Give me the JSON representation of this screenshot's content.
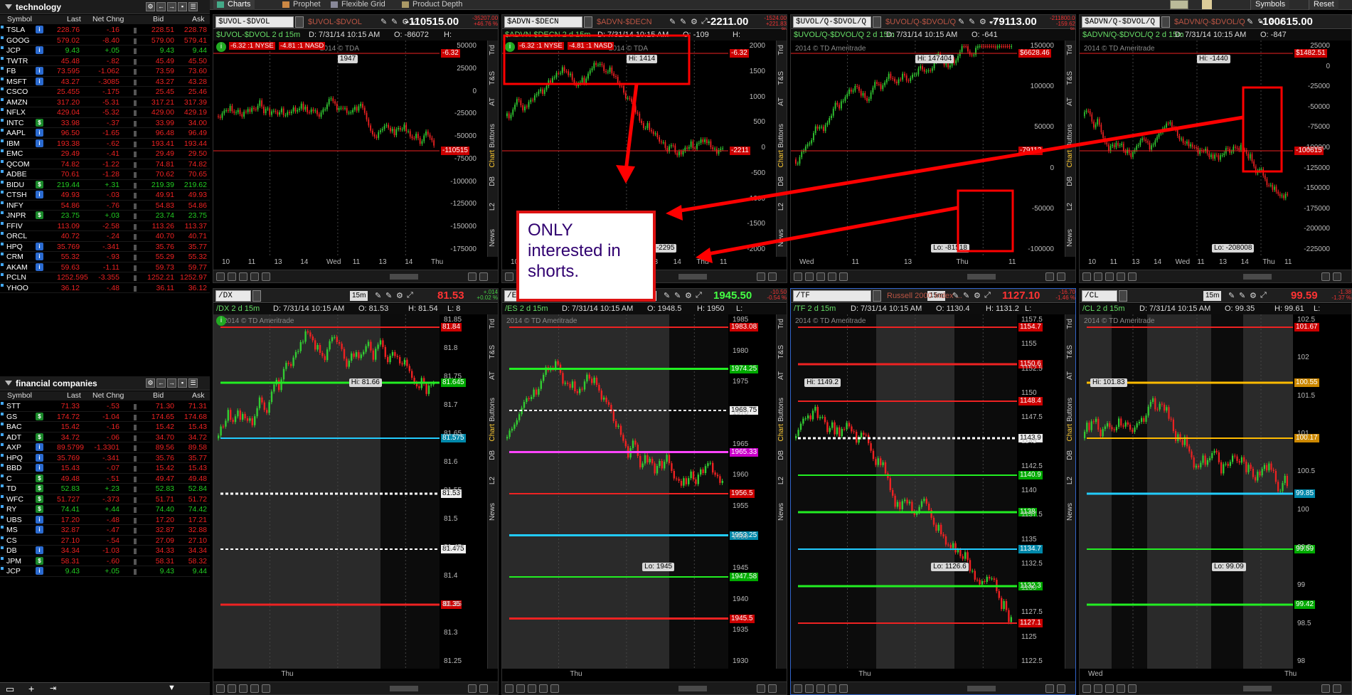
{
  "topbar": {
    "tabs": [
      "Charts",
      "Prophet",
      "Flexible Grid",
      "Product Depth"
    ],
    "right": [
      "Symbols",
      "Reset"
    ]
  },
  "watchlists": [
    {
      "title": "technology",
      "headers": [
        "Symbol",
        "Last",
        "Net Chng",
        "Bid",
        "Ask"
      ],
      "rows": [
        [
          "TSLA",
          "228.76",
          "-.16",
          "228.51",
          "228.78",
          "red",
          "blue"
        ],
        [
          "GOOG",
          "579.02",
          "-8.40",
          "579.00",
          "579.41",
          "red",
          ""
        ],
        [
          "JCP",
          "9.43",
          "+.05",
          "9.43",
          "9.44",
          "green",
          "blue"
        ],
        [
          "TWTR",
          "45.48",
          "-.82",
          "45.49",
          "45.50",
          "red",
          ""
        ],
        [
          "FB",
          "73.595",
          "-1.062",
          "73.59",
          "73.60",
          "red",
          "blue"
        ],
        [
          "MSFT",
          "43.27",
          "-.3085",
          "43.27",
          "43.28",
          "red",
          "blue"
        ],
        [
          "CSCO",
          "25.455",
          "-.175",
          "25.45",
          "25.46",
          "red",
          ""
        ],
        [
          "AMZN",
          "317.20",
          "-5.31",
          "317.21",
          "317.39",
          "red",
          ""
        ],
        [
          "NFLX",
          "429.04",
          "-5.32",
          "429.00",
          "429.19",
          "red",
          ""
        ],
        [
          "INTC",
          "33.98",
          "-.37",
          "33.99",
          "34.00",
          "red",
          "green"
        ],
        [
          "AAPL",
          "96.50",
          "-1.65",
          "96.48",
          "96.49",
          "red",
          "blue"
        ],
        [
          "IBM",
          "193.38",
          "-.62",
          "193.41",
          "193.44",
          "red",
          "blue"
        ],
        [
          "EMC",
          "29.49",
          "-.41",
          "29.49",
          "29.50",
          "red",
          ""
        ],
        [
          "QCOM",
          "74.82",
          "-1.22",
          "74.81",
          "74.82",
          "red",
          ""
        ],
        [
          "ADBE",
          "70.61",
          "-1.28",
          "70.62",
          "70.65",
          "red",
          ""
        ],
        [
          "BIDU",
          "219.44",
          "+.31",
          "219.39",
          "219.62",
          "green",
          "green"
        ],
        [
          "CTSH",
          "49.93",
          "-.03",
          "49.91",
          "49.93",
          "red",
          "blue"
        ],
        [
          "INFY",
          "54.86",
          "-.76",
          "54.83",
          "54.86",
          "red",
          ""
        ],
        [
          "JNPR",
          "23.75",
          "+.03",
          "23.74",
          "23.75",
          "green",
          "green"
        ],
        [
          "FFIV",
          "113.09",
          "-2.58",
          "113.26",
          "113.37",
          "red",
          ""
        ],
        [
          "ORCL",
          "40.72",
          "-.24",
          "40.70",
          "40.71",
          "red",
          ""
        ],
        [
          "HPQ",
          "35.769",
          "-.341",
          "35.76",
          "35.77",
          "red",
          "blue"
        ],
        [
          "CRM",
          "55.32",
          "-.93",
          "55.29",
          "55.32",
          "red",
          "blue"
        ],
        [
          "AKAM",
          "59.63",
          "-1.11",
          "59.73",
          "59.77",
          "red",
          "blue"
        ],
        [
          "PCLN",
          "1252.595",
          "-3.355",
          "1252.21",
          "1252.97",
          "red",
          ""
        ],
        [
          "YHOO",
          "36.12",
          "-.48",
          "36.11",
          "36.12",
          "red",
          ""
        ]
      ]
    },
    {
      "title": "financial companies",
      "headers": [
        "Symbol",
        "Last",
        "Net Chng",
        "Bid",
        "Ask"
      ],
      "rows": [
        [
          "STT",
          "71.33",
          "-.53",
          "71.30",
          "71.31",
          "red",
          ""
        ],
        [
          "GS",
          "174.72",
          "-1.04",
          "174.65",
          "174.68",
          "red",
          "green"
        ],
        [
          "BAC",
          "15.42",
          "-.16",
          "15.42",
          "15.43",
          "red",
          ""
        ],
        [
          "ADT",
          "34.72",
          "-.06",
          "34.70",
          "34.72",
          "red",
          "green"
        ],
        [
          "AXP",
          "89.5799",
          "-1.3301",
          "89.56",
          "89.58",
          "red",
          "blue"
        ],
        [
          "HPQ",
          "35.769",
          "-.341",
          "35.76",
          "35.77",
          "red",
          "blue"
        ],
        [
          "BBD",
          "15.43",
          "-.07",
          "15.42",
          "15.43",
          "red",
          "blue"
        ],
        [
          "C",
          "49.48",
          "-.51",
          "49.47",
          "49.48",
          "red",
          "green"
        ],
        [
          "TD",
          "52.83",
          "+.23",
          "52.83",
          "52.84",
          "green",
          "green"
        ],
        [
          "WFC",
          "51.727",
          "-.373",
          "51.71",
          "51.72",
          "red",
          "green"
        ],
        [
          "RY",
          "74.41",
          "+.44",
          "74.40",
          "74.42",
          "green",
          "green"
        ],
        [
          "UBS",
          "17.20",
          "-.48",
          "17.20",
          "17.21",
          "red",
          "blue"
        ],
        [
          "MS",
          "32.87",
          "-.47",
          "32.87",
          "32.88",
          "red",
          "blue"
        ],
        [
          "CS",
          "27.10",
          "-.54",
          "27.09",
          "27.10",
          "red",
          ""
        ],
        [
          "DB",
          "34.34",
          "-1.03",
          "34.33",
          "34.34",
          "red",
          "blue"
        ],
        [
          "JPM",
          "58.31",
          "-.60",
          "58.31",
          "58.32",
          "red",
          "green"
        ],
        [
          "JCP",
          "9.43",
          "+.05",
          "9.43",
          "9.44",
          "green",
          "blue"
        ]
      ]
    }
  ],
  "panels": [
    {
      "sym": "$UVOL-$DVOL",
      "ghost": "$UVOL-$DVOL",
      "price": "-110515.00",
      "small1": "-35207.00",
      "small2": "+46.76 %",
      "info": [
        "$UVOL-$DVOL 2 d 15m",
        "D: 7/31/14 10:15 AM",
        "O: -86072",
        "H:"
      ],
      "yticks": [
        "50000",
        "25000",
        "0",
        "-25000",
        "-50000",
        "-75000",
        "-100000",
        "-125000",
        "-150000",
        "-175000"
      ],
      "xticks": [
        "10",
        "11",
        "13",
        "14",
        "Wed",
        "11",
        "13",
        "14",
        "Thu"
      ],
      "tags": [
        [
          "-6.32",
          "#c00"
        ],
        [
          "-110515",
          "#c00"
        ]
      ],
      "hi": "1947",
      "lo": "",
      "flags": [
        "-6.32 :1 NYSE",
        "-4.81 :1 NASD"
      ],
      "copyright": "2014 © TDA"
    },
    {
      "sym": "$ADVN-$DECN",
      "ghost": "$ADVN-$DECN",
      "price": "-2211.00",
      "small1": "-1524.00",
      "small2": "+221.83 %",
      "info": [
        "$ADVN-$DECN 2 d 15m",
        "D: 7/31/14 10:15 AM",
        "O: -109",
        "H:"
      ],
      "yticks": [
        "2000",
        "1500",
        "1000",
        "500",
        "0",
        "-500",
        "-1000",
        "-1500",
        "-2000"
      ],
      "xticks": [
        "10",
        "11",
        "13",
        "14",
        "Wed",
        "11",
        "13",
        "14",
        "Thu",
        "11"
      ],
      "tags": [
        [
          "-6.32",
          "#c00"
        ],
        [
          "-2211",
          "#c00"
        ]
      ],
      "hi": "Hi: 1414",
      "lo": "Lo: -2295",
      "flags": [
        "-6.32 :1 NYSE",
        "-4.81 :1 NASD"
      ],
      "copyright": "2014 © TDA"
    },
    {
      "sym": "$UVOL/Q-$DVOL/Q",
      "ghost": "$UVOL/Q-$DVOL/Q",
      "price": "-79113.00",
      "small1": "-211800.00",
      "small2": "-159.62 %",
      "info": [
        "$UVOL/Q-$DVOL/Q 2 d 15m",
        "D: 7/31/14 10:15 AM",
        "O: -641"
      ],
      "yticks": [
        "150000",
        "100000",
        "50000",
        "0",
        "-50000",
        "-100000"
      ],
      "xticks": [
        "Wed",
        "11",
        "13",
        "Thu",
        "11"
      ],
      "tags": [
        [
          "$6628.46",
          "#c00"
        ],
        [
          "-79113",
          "#c00"
        ]
      ],
      "hi": "Hi: 147404",
      "lo": "Lo: -81518",
      "flags": [],
      "copyright": "2014 © TD Ameritrade"
    },
    {
      "sym": "$ADVN/Q-$DVOL/Q",
      "ghost": "$ADVN/Q-$DVOL/Q",
      "price": "-100615.00",
      "small1": "",
      "small2": "",
      "info": [
        "$ADVN/Q-$DVOL/Q 2 d 15m",
        "D: 7/31/14 10:15 AM",
        "O: -847"
      ],
      "yticks": [
        "25000",
        "0",
        "-25000",
        "-50000",
        "-75000",
        "-100000",
        "-125000",
        "-150000",
        "-175000",
        "-200000",
        "-225000"
      ],
      "xticks": [
        "10",
        "11",
        "13",
        "14",
        "Wed",
        "11",
        "13",
        "14",
        "Thu",
        "11"
      ],
      "tags": [
        [
          "$1482.51",
          "#c00"
        ],
        [
          "-100615",
          "#c00"
        ]
      ],
      "hi": "Hi: -1440",
      "lo": "Lo: -208008",
      "flags": [],
      "copyright": "2014 © TD Ameritrade"
    },
    {
      "sym": "/DX",
      "ghost": "",
      "price": "81.53",
      "small1": "+.014",
      "small2": "+0.02 %",
      "period": "15m",
      "info": [
        "/DX 2 d 15m",
        "D: 7/31/14 10:15 AM",
        "O: 81.53",
        "H: 81.54",
        "L: 8"
      ],
      "yticks": [
        "81.85",
        "81.8",
        "81.75",
        "81.7",
        "81.65",
        "81.6",
        "81.55",
        "81.5",
        "81.45",
        "81.4",
        "81.35",
        "81.3",
        "81.25"
      ],
      "xticks": [
        "Thu"
      ],
      "tags": [
        [
          "81.84",
          "#c00"
        ],
        [
          "81.645",
          "#0a0"
        ],
        [
          "81.575",
          "#08a"
        ],
        [
          "81.53",
          "#333"
        ],
        [
          "81.475",
          "#333"
        ],
        [
          "81.35",
          "#c00"
        ]
      ],
      "hi": "Hi: 81.66",
      "lo": "",
      "flags": [],
      "copyright": "2014 © TD Ameritrade"
    },
    {
      "sym": "/ES",
      "ghost": "Index...",
      "price": "1945.50",
      "small1": "-10.50",
      "small2": "-0.54 %",
      "period": "15m",
      "info": [
        "/ES 2 d 15m",
        "D: 7/31/14 10:15 AM",
        "O: 1948.5",
        "H: 1950",
        "L:"
      ],
      "yticks": [
        "1985",
        "1980",
        "1975",
        "1970",
        "1965",
        "1960",
        "1955",
        "1950",
        "1945",
        "1940",
        "1935",
        "1930"
      ],
      "xticks": [
        "Thu"
      ],
      "tags": [
        [
          "1983.08",
          "#c00"
        ],
        [
          "1974.25",
          "#0a0"
        ],
        [
          "1968.75",
          "#333"
        ],
        [
          "1965.33",
          "#c0c"
        ],
        [
          "1956.5",
          "#c00"
        ],
        [
          "1953.25",
          "#08a"
        ],
        [
          "1947.58",
          "#0a0"
        ],
        [
          "1945.5",
          "#c00"
        ]
      ],
      "hi": "",
      "lo": "Lo: 1945",
      "flags": [],
      "copyright": "2014 © TD Ameritrade"
    },
    {
      "sym": "/TF",
      "ghost": "Russell 2000 Index ...",
      "price": "1127.10",
      "small1": "-16.70",
      "small2": "-1.46 %",
      "period": "15m",
      "info": [
        "/TF 2 d 15m",
        "D: 7/31/14 10:15 AM",
        "O: 1130.4",
        "H: 1131.2",
        "L:"
      ],
      "yticks": [
        "1157.5",
        "1155",
        "1152.5",
        "1150",
        "1147.5",
        "1145",
        "1142.5",
        "1140",
        "1137.5",
        "1135",
        "1132.5",
        "1130",
        "1127.5",
        "1125",
        "1122.5"
      ],
      "xticks": [
        "Thu"
      ],
      "tags": [
        [
          "1154.7",
          "#c00"
        ],
        [
          "1150.6",
          "#c00"
        ],
        [
          "1148.4",
          "#c00"
        ],
        [
          "1143.9",
          "#333"
        ],
        [
          "1140.9",
          "#0a0"
        ],
        [
          "1138",
          "#0a0"
        ],
        [
          "1134.7",
          "#08a"
        ],
        [
          "1132.3",
          "#0a0"
        ],
        [
          "1127.1",
          "#c00"
        ]
      ],
      "hi": "Hi: 1149.2",
      "lo": "Lo: 1126.6",
      "flags": [],
      "copyright": "2014 © TD Ameritrade"
    },
    {
      "sym": "/CL",
      "ghost": "",
      "price": "99.59",
      "small1": "-1.38",
      "small2": "-1.37 %",
      "period": "15m",
      "info": [
        "/CL 2 d 15m",
        "D: 7/31/14 10:15 AM",
        "O: 99.35",
        "H: 99.61",
        "L:"
      ],
      "yticks": [
        "102.5",
        "102",
        "101.5",
        "101",
        "100.5",
        "100",
        "99.5",
        "99",
        "98.5",
        "98"
      ],
      "xticks": [
        "Wed",
        "Thu"
      ],
      "tags": [
        [
          "101.67",
          "#c00"
        ],
        [
          "100.55",
          "#c80"
        ],
        [
          "100.17",
          "#c80"
        ],
        [
          "99.85",
          "#08a"
        ],
        [
          "99.59",
          "#0a0"
        ],
        [
          "99.42",
          "#0a0"
        ]
      ],
      "hi": "Hi: 101.83",
      "lo": "Lo: 99.09",
      "flags": [],
      "copyright": "2014 © TD Ameritrade"
    }
  ],
  "callout": "ONLY interested in shorts.",
  "sidetabs": [
    "Trd",
    "T&S",
    "AT",
    "Buttons",
    "Chart",
    "DB",
    "L2",
    "News"
  ]
}
